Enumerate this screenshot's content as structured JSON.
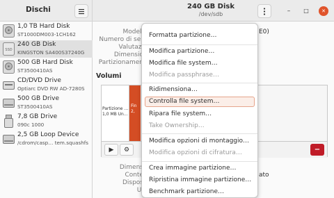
{
  "app": {
    "title": "Dischi"
  },
  "header": {
    "title": "240 GB Disk",
    "subtitle": "/dev/sdb",
    "menu_icon": "hamburger-icon",
    "kebab_icon": "kebab-icon"
  },
  "window_controls": {
    "minimize": "–",
    "maximize": "□",
    "close": "✕",
    "close_color": "#e0542b"
  },
  "sidebar": {
    "items": [
      {
        "name": "1,0 TB Hard Disk",
        "sub": "ST1000DM003-1CH162",
        "icon": "hard-disk-icon"
      },
      {
        "name": "240 GB Disk",
        "sub": "KINGSTON SA400S37240G",
        "icon": "ssd-icon",
        "selected": true
      },
      {
        "name": "500 GB Hard Disk",
        "sub": "ST3500410AS",
        "icon": "hard-disk-icon"
      },
      {
        "name": "CD/DVD Drive",
        "sub": "Optiarc DVD RW AD-7280S",
        "icon": "optical-drive-icon"
      },
      {
        "name": "500 GB Drive",
        "sub": "ST3500410AS",
        "icon": "drive-icon"
      },
      {
        "name": "7,8 GB Drive",
        "sub": "090c 1000",
        "icon": "usb-drive-icon"
      },
      {
        "name": "2,5 GB Loop Device",
        "sub": "/cdrom/casp… tem.squashfs",
        "icon": "loop-device-icon"
      }
    ]
  },
  "details": {
    "labels": [
      "Modell",
      "Numero di ser",
      "Valutazi",
      "Dimensio",
      "Partizionamen"
    ],
    "model_value_tail": "E0)",
    "section_title": "Volumi",
    "lower_labels": [
      "Dimens",
      "Conte",
      "Dispos",
      "UI"
    ],
    "lower_value_tail": "ato"
  },
  "volumes": {
    "free_label": "Partizione …\n1,0 MB Un…",
    "part_label": "Fin\n2,"
  },
  "toolbar": {
    "play_icon": "▶",
    "gear_icon": "⚙",
    "delete_icon": "−",
    "delete_color": "#c01c28"
  },
  "menu": {
    "items": [
      {
        "label": "Formatta partizione…",
        "disabled": false
      },
      {
        "sep": true
      },
      {
        "label": "Modifica partizione…",
        "disabled": false
      },
      {
        "label": "Modifica file system…",
        "disabled": false
      },
      {
        "label": "Modifica passphrase…",
        "disabled": true
      },
      {
        "sep": true
      },
      {
        "label": "Ridimensiona…",
        "disabled": false
      },
      {
        "label": "Controlla file system…",
        "disabled": false,
        "hover": true
      },
      {
        "label": "Ripara file system…",
        "disabled": false
      },
      {
        "label": "Take Ownership…",
        "disabled": true
      },
      {
        "sep": true
      },
      {
        "label": "Modifica opzioni di montaggio…",
        "disabled": false
      },
      {
        "label": "Modifica opzioni di cifratura…",
        "disabled": true
      },
      {
        "sep": true
      },
      {
        "label": "Crea immagine partizione…",
        "disabled": false
      },
      {
        "label": "Ripristina immagine partizione…",
        "disabled": false
      },
      {
        "label": "Benchmark partizione…",
        "disabled": false
      }
    ]
  }
}
